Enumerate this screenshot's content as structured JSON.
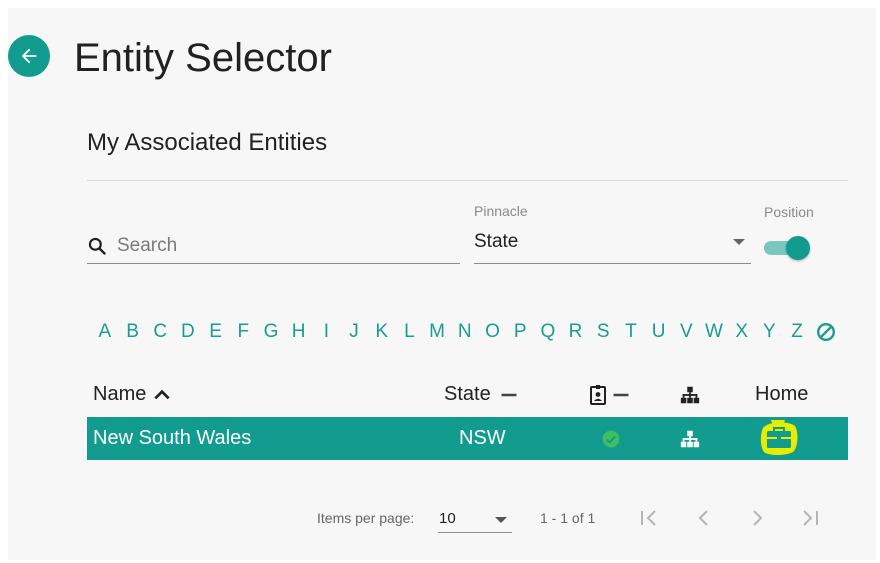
{
  "header": {
    "title": "Entity Selector"
  },
  "section": {
    "title": "My Associated Entities"
  },
  "search": {
    "placeholder": "Search",
    "value": ""
  },
  "pinnacle": {
    "label": "Pinnacle",
    "value": "State"
  },
  "position_toggle": {
    "label": "Position",
    "checked": true
  },
  "alphabet": [
    "A",
    "B",
    "C",
    "D",
    "E",
    "F",
    "G",
    "H",
    "I",
    "J",
    "K",
    "L",
    "M",
    "N",
    "O",
    "P",
    "Q",
    "R",
    "S",
    "T",
    "U",
    "V",
    "W",
    "X",
    "Y",
    "Z"
  ],
  "table": {
    "headers": {
      "name": "Name",
      "state": "State",
      "badge_icon": "contact-badge-icon",
      "hierarchy_icon": "hierarchy-icon",
      "home": "Home"
    },
    "rows": [
      {
        "name": "New South Wales",
        "state": "NSW",
        "status_icon": "check-circle-icon",
        "hierarchy_icon": "hierarchy-icon",
        "home_icon": "briefcase-icon"
      }
    ]
  },
  "paginator": {
    "items_per_page_label": "Items per page:",
    "page_size": "10",
    "range_label": "1 - 1 of 1"
  },
  "colors": {
    "accent": "#119c8f",
    "accent_light": "#7ac7c0",
    "highlight": "#e5ee00",
    "background": "#f7f7f7"
  }
}
